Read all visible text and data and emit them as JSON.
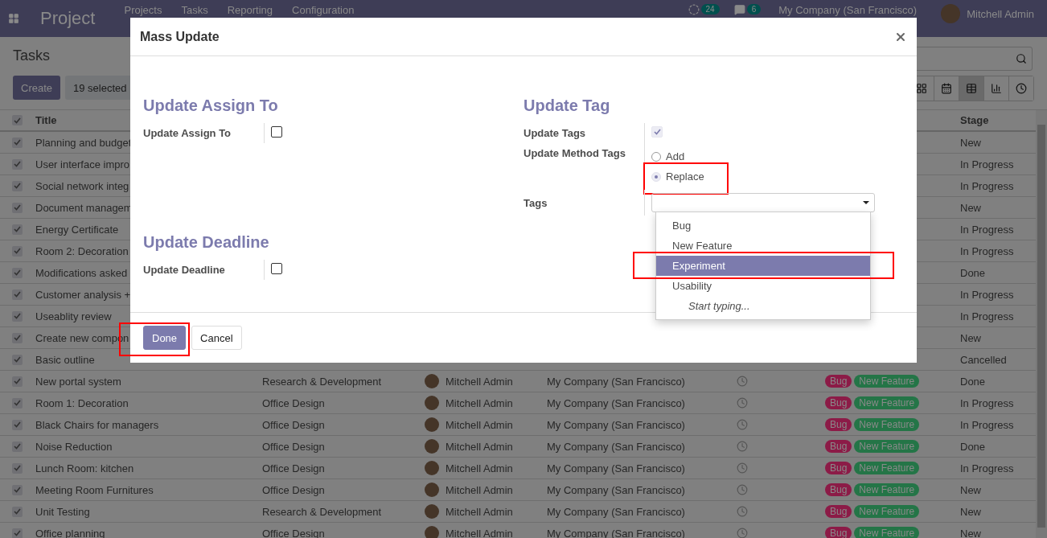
{
  "navbar": {
    "app": "Project",
    "menu": [
      "Projects",
      "Tasks",
      "Reporting",
      "Configuration"
    ],
    "activity_count": "24",
    "message_count": "6",
    "company": "My Company (San Francisco)",
    "user": "Mitchell Admin"
  },
  "control_panel": {
    "breadcrumb": "Tasks",
    "create": "Create",
    "selection": "19 selected",
    "views": [
      {
        "kind": "kanban",
        "selected": false
      },
      {
        "kind": "calendar",
        "selected": false
      },
      {
        "kind": "list",
        "selected": true
      },
      {
        "kind": "graph",
        "selected": false
      },
      {
        "kind": "activity",
        "selected": false
      }
    ]
  },
  "table": {
    "header": {
      "checked": true,
      "title": "Title",
      "stage": "Stage"
    },
    "rows": [
      {
        "checked": true,
        "title": "Planning and budget",
        "stage": "New"
      },
      {
        "checked": true,
        "title": "User interface impro",
        "stage": "In Progress"
      },
      {
        "checked": true,
        "title": "Social network integ",
        "stage": "In Progress"
      },
      {
        "checked": true,
        "title": "Document managem",
        "stage": "New"
      },
      {
        "checked": true,
        "title": "Energy Certificate",
        "stage": "In Progress"
      },
      {
        "checked": true,
        "title": "Room 2: Decoration",
        "stage": "In Progress"
      },
      {
        "checked": true,
        "title": "Modifications asked",
        "stage": "Done"
      },
      {
        "checked": true,
        "title": "Customer analysis +",
        "stage": "In Progress"
      },
      {
        "checked": true,
        "title": "Useablity review",
        "stage": "In Progress"
      },
      {
        "checked": true,
        "title": "Create new compon",
        "stage": "New"
      },
      {
        "checked": true,
        "title": "Basic outline",
        "stage": "Cancelled"
      },
      {
        "checked": true,
        "title": "New portal system",
        "project": "Research & Development",
        "assignee": "Mitchell Admin",
        "company": "My Company (San Francisco)",
        "tags": [
          {
            "label": "Bug",
            "color": "#8c1b47"
          },
          {
            "label": "New Feature",
            "color": "#247547"
          }
        ],
        "stage": "Done"
      },
      {
        "checked": true,
        "title": "Room 1: Decoration",
        "project": "Office Design",
        "assignee": "Mitchell Admin",
        "company": "My Company (San Francisco)",
        "tags": [
          {
            "label": "Bug",
            "color": "#8c1b47"
          },
          {
            "label": "New Feature",
            "color": "#247547"
          }
        ],
        "stage": "In Progress"
      },
      {
        "checked": true,
        "title": "Black Chairs for managers",
        "project": "Office Design",
        "assignee": "Mitchell Admin",
        "company": "My Company (San Francisco)",
        "tags": [
          {
            "label": "Bug",
            "color": "#8c1b47"
          },
          {
            "label": "New Feature",
            "color": "#247547"
          }
        ],
        "stage": "In Progress"
      },
      {
        "checked": true,
        "title": "Noise Reduction",
        "project": "Office Design",
        "assignee": "Mitchell Admin",
        "company": "My Company (San Francisco)",
        "tags": [
          {
            "label": "Bug",
            "color": "#8c1b47"
          },
          {
            "label": "New Feature",
            "color": "#247547"
          }
        ],
        "stage": "Done"
      },
      {
        "checked": true,
        "title": "Lunch Room: kitchen",
        "project": "Office Design",
        "assignee": "Mitchell Admin",
        "company": "My Company (San Francisco)",
        "tags": [
          {
            "label": "Bug",
            "color": "#8c1b47"
          },
          {
            "label": "New Feature",
            "color": "#247547"
          }
        ],
        "stage": "In Progress"
      },
      {
        "checked": true,
        "title": "Meeting Room Furnitures",
        "project": "Office Design",
        "assignee": "Mitchell Admin",
        "company": "My Company (San Francisco)",
        "tags": [
          {
            "label": "Bug",
            "color": "#8c1b47"
          },
          {
            "label": "New Feature",
            "color": "#247547"
          }
        ],
        "stage": "New"
      },
      {
        "checked": true,
        "title": "Unit Testing",
        "project": "Research & Development",
        "assignee": "Mitchell Admin",
        "company": "My Company (San Francisco)",
        "tags": [
          {
            "label": "Bug",
            "color": "#8c1b47"
          },
          {
            "label": "New Feature",
            "color": "#247547"
          }
        ],
        "stage": "New"
      },
      {
        "checked": true,
        "title": "Office planning",
        "project": "Office Design",
        "assignee": "Mitchell Admin",
        "company": "My Company (San Francisco)",
        "tags": [
          {
            "label": "Bug",
            "color": "#8c1b47"
          },
          {
            "label": "New Feature",
            "color": "#247547"
          }
        ],
        "stage": "New"
      }
    ]
  },
  "dialog": {
    "title": "Mass Update",
    "columns": [
      [
        {
          "title": "Update Assign To",
          "fields": [
            {
              "kind": "checkbox",
              "label": "Update Assign To",
              "checked": false
            }
          ]
        },
        {
          "title": "Update Deadline",
          "fields": [
            {
              "kind": "checkbox",
              "label": "Update Deadline",
              "checked": false
            }
          ]
        }
      ],
      [
        {
          "title": "Update Tag",
          "fields": [
            {
              "kind": "checkbox",
              "label": "Update Tags",
              "checked": true
            },
            {
              "kind": "radio",
              "label": "Update Method Tags",
              "options": [
                {
                  "label": "Add",
                  "selected": false,
                  "highlighted": false
                },
                {
                  "label": "Replace",
                  "selected": true,
                  "highlighted": true
                }
              ]
            },
            {
              "kind": "select",
              "label": "Tags",
              "open": true,
              "options": [
                {
                  "label": "Bug",
                  "selected": false,
                  "highlighted": false
                },
                {
                  "label": "New Feature",
                  "selected": false,
                  "highlighted": false
                },
                {
                  "label": "Experiment",
                  "selected": true,
                  "highlighted": true
                },
                {
                  "label": "Usability",
                  "selected": false,
                  "highlighted": false
                }
              ],
              "hint": "Start typing..."
            }
          ]
        }
      ]
    ],
    "buttons": [
      {
        "label": "Done",
        "kind": "primary",
        "highlighted": true
      },
      {
        "label": "Cancel",
        "kind": "secondary",
        "highlighted": false
      }
    ]
  }
}
